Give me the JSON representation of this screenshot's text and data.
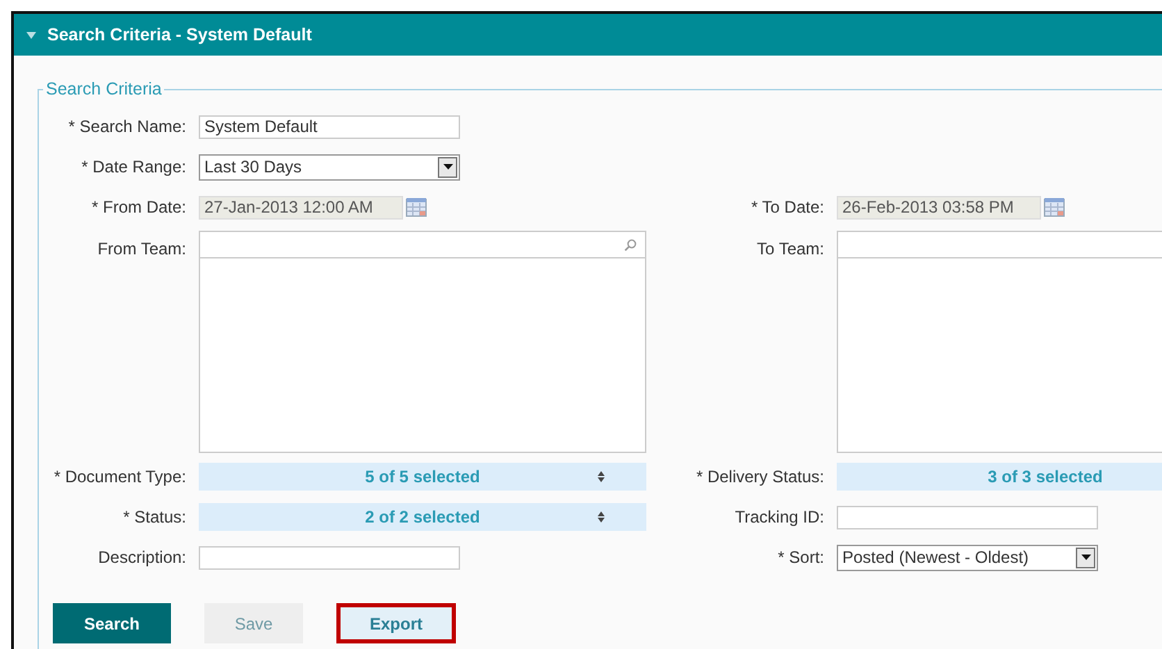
{
  "panel": {
    "title": "Search Criteria - System Default",
    "expanded": true
  },
  "fieldset": {
    "legend": "Search Criteria"
  },
  "rows": [
    [
      {
        "kind": "text",
        "label": "* Search Name:",
        "value": "System Default"
      }
    ],
    [
      {
        "kind": "select",
        "label": "* Date Range:",
        "value": "Last 30 Days"
      }
    ],
    [
      {
        "kind": "date",
        "label": "* From Date:",
        "value": "27-Jan-2013 12:00 AM",
        "disabled": true
      },
      {
        "kind": "date",
        "label": "* To Date:",
        "value": "26-Feb-2013 03:58 PM",
        "disabled": true
      }
    ],
    [
      {
        "kind": "team",
        "label": "From Team:"
      },
      {
        "kind": "team",
        "label": "To Team:"
      }
    ],
    [
      {
        "kind": "multiselect",
        "label": "* Document Type:",
        "value": "5 of 5 selected"
      },
      {
        "kind": "multiselect",
        "label": "* Delivery Status:",
        "value": "3 of 3 selected"
      }
    ],
    [
      {
        "kind": "multiselect",
        "label": "* Status:",
        "value": "2 of 2 selected"
      },
      {
        "kind": "text",
        "label": "Tracking ID:"
      }
    ],
    [
      {
        "kind": "text",
        "label": "Description:"
      },
      {
        "kind": "select",
        "label": "* Sort:",
        "value": "Posted (Newest - Oldest)"
      }
    ]
  ],
  "buttons": [
    {
      "label": "Search",
      "kind": "primary",
      "disabled": false,
      "highlighted": false
    },
    {
      "label": "Save",
      "kind": "secondary",
      "disabled": true,
      "highlighted": false
    },
    {
      "label": "Export",
      "kind": "secondary",
      "disabled": false,
      "highlighted": true
    }
  ]
}
